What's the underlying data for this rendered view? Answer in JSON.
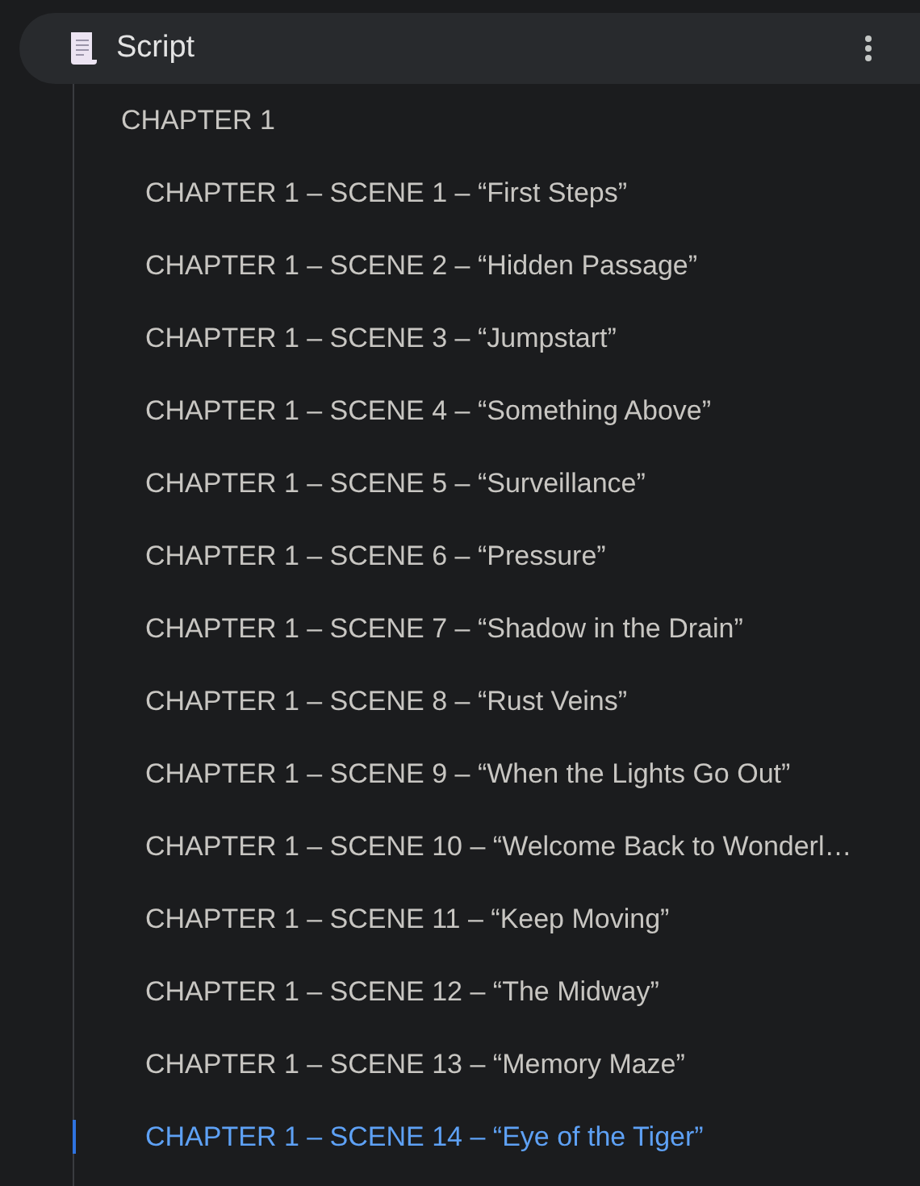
{
  "header": {
    "title": "Script"
  },
  "outline": [
    {
      "label": "CHAPTER 1",
      "selected": false,
      "children": [
        {
          "label": "CHAPTER 1 – SCENE 1 – “First Steps”",
          "selected": false
        },
        {
          "label": "CHAPTER 1 – SCENE 2 – “Hidden Passage”",
          "selected": false
        },
        {
          "label": "CHAPTER 1 – SCENE 3 – “Jumpstart”",
          "selected": false
        },
        {
          "label": "CHAPTER 1 – SCENE 4 – “Something Above”",
          "selected": false
        },
        {
          "label": "CHAPTER 1 – SCENE 5 – “Surveillance”",
          "selected": false
        },
        {
          "label": "CHAPTER 1 – SCENE 6 – “Pressure”",
          "selected": false
        },
        {
          "label": "CHAPTER 1 – SCENE 7 – “Shadow in the Drain”",
          "selected": false
        },
        {
          "label": "CHAPTER 1 – SCENE 8 – “Rust Veins”",
          "selected": false
        },
        {
          "label": "CHAPTER 1 – SCENE 9 – “When the Lights Go Out”",
          "selected": false
        },
        {
          "label": "CHAPTER 1 – SCENE 10 – “Welcome Back to Wonderl…",
          "selected": false
        },
        {
          "label": "CHAPTER 1 – SCENE 11 – “Keep Moving”",
          "selected": false
        },
        {
          "label": "CHAPTER 1 – SCENE 12 – “The Midway”",
          "selected": false
        },
        {
          "label": "CHAPTER 1 – SCENE 13 – “Memory Maze”",
          "selected": false
        },
        {
          "label": "CHAPTER 1 – SCENE 14 – “Eye of the Tiger”",
          "selected": true
        }
      ]
    }
  ]
}
